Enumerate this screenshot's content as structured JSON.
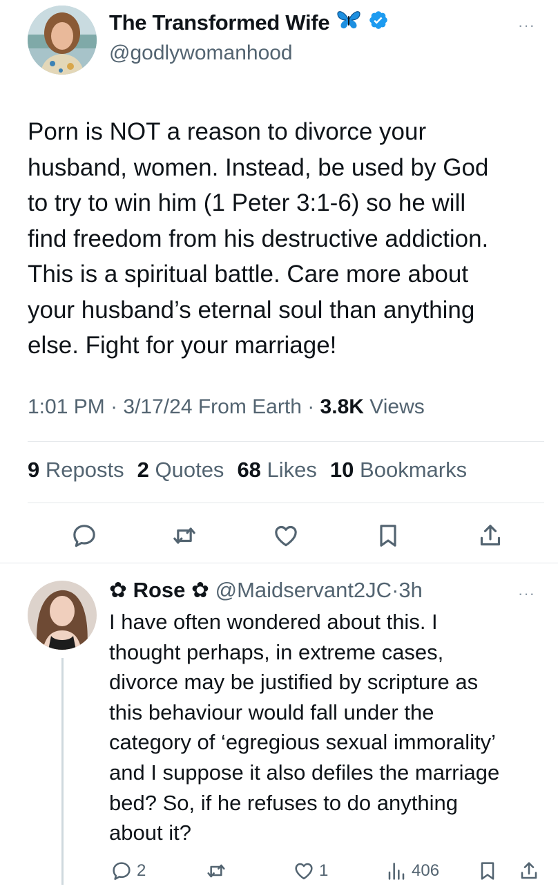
{
  "tweet": {
    "author_name": "The Transformed Wife",
    "author_handle": "@godlywomanhood",
    "badge_emoji": "butterfly-icon",
    "verified_icon": "verified-badge-icon",
    "text_lines": [
      "Porn is NOT a reason to divorce your",
      "husband, women. Instead, be used by God",
      "to try to win him (1 Peter 3:1-6) so he will",
      "find freedom from his destructive addiction.",
      "This is a spiritual battle. Care more about",
      "your husband’s eternal soul than anything",
      "else. Fight for your marriage!"
    ],
    "time": "1:01 PM",
    "date": "3/17/24",
    "location": "From Earth",
    "views_count": "3.8K",
    "views_label": "Views",
    "stats": [
      {
        "count": "9",
        "label": "Reposts"
      },
      {
        "count": "2",
        "label": "Quotes"
      },
      {
        "count": "68",
        "label": "Likes"
      },
      {
        "count": "10",
        "label": "Bookmarks"
      }
    ],
    "more": "···"
  },
  "reply": {
    "name": "✿ Rose ✿",
    "handle": "@Maidservant2JC",
    "age": "3h",
    "more": "···",
    "text_lines": [
      "I have often wondered about this. I",
      "thought perhaps, in extreme cases,",
      "divorce may be justified by scripture as",
      "this behaviour would fall under the",
      "category of ‘egregious sexual immorality’",
      "and I suppose it also defiles the marriage",
      "bed? So, if he refuses to do anything",
      "about it?"
    ],
    "reply_count": "2",
    "like_count": "1",
    "view_count": "406"
  },
  "colors": {
    "text": "#0f1419",
    "secondary": "#536471",
    "icon": "#536471",
    "verified": "#1d9bf0",
    "divider": "#e3e7ea"
  }
}
